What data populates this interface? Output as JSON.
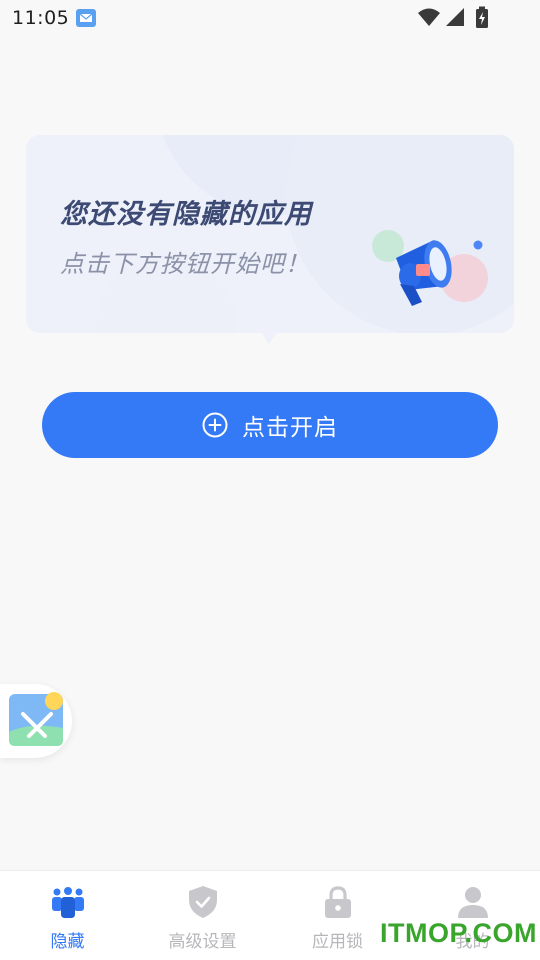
{
  "status_bar": {
    "time": "11:05"
  },
  "empty_card": {
    "title": "您还没有隐藏的应用",
    "subtitle": "点击下方按钮开始吧！"
  },
  "start_button": {
    "label": "点击开启",
    "icon": "plus-circle-icon"
  },
  "floating_widget": {
    "icon": "image-edit-icon"
  },
  "bottom_nav": {
    "items": [
      {
        "label": "隐藏",
        "icon": "people-icon",
        "active": true
      },
      {
        "label": "高级设置",
        "icon": "shield-check-icon",
        "active": false
      },
      {
        "label": "应用锁",
        "icon": "lock-icon",
        "active": false
      },
      {
        "label": "我的",
        "icon": "user-icon",
        "active": false
      }
    ]
  },
  "watermark": "ITMOP.COM",
  "colors": {
    "accent": "#3479f5",
    "inactive": "#b7b7bb",
    "card_bg": "#eef1fa",
    "watermark": "#3aa52c"
  }
}
